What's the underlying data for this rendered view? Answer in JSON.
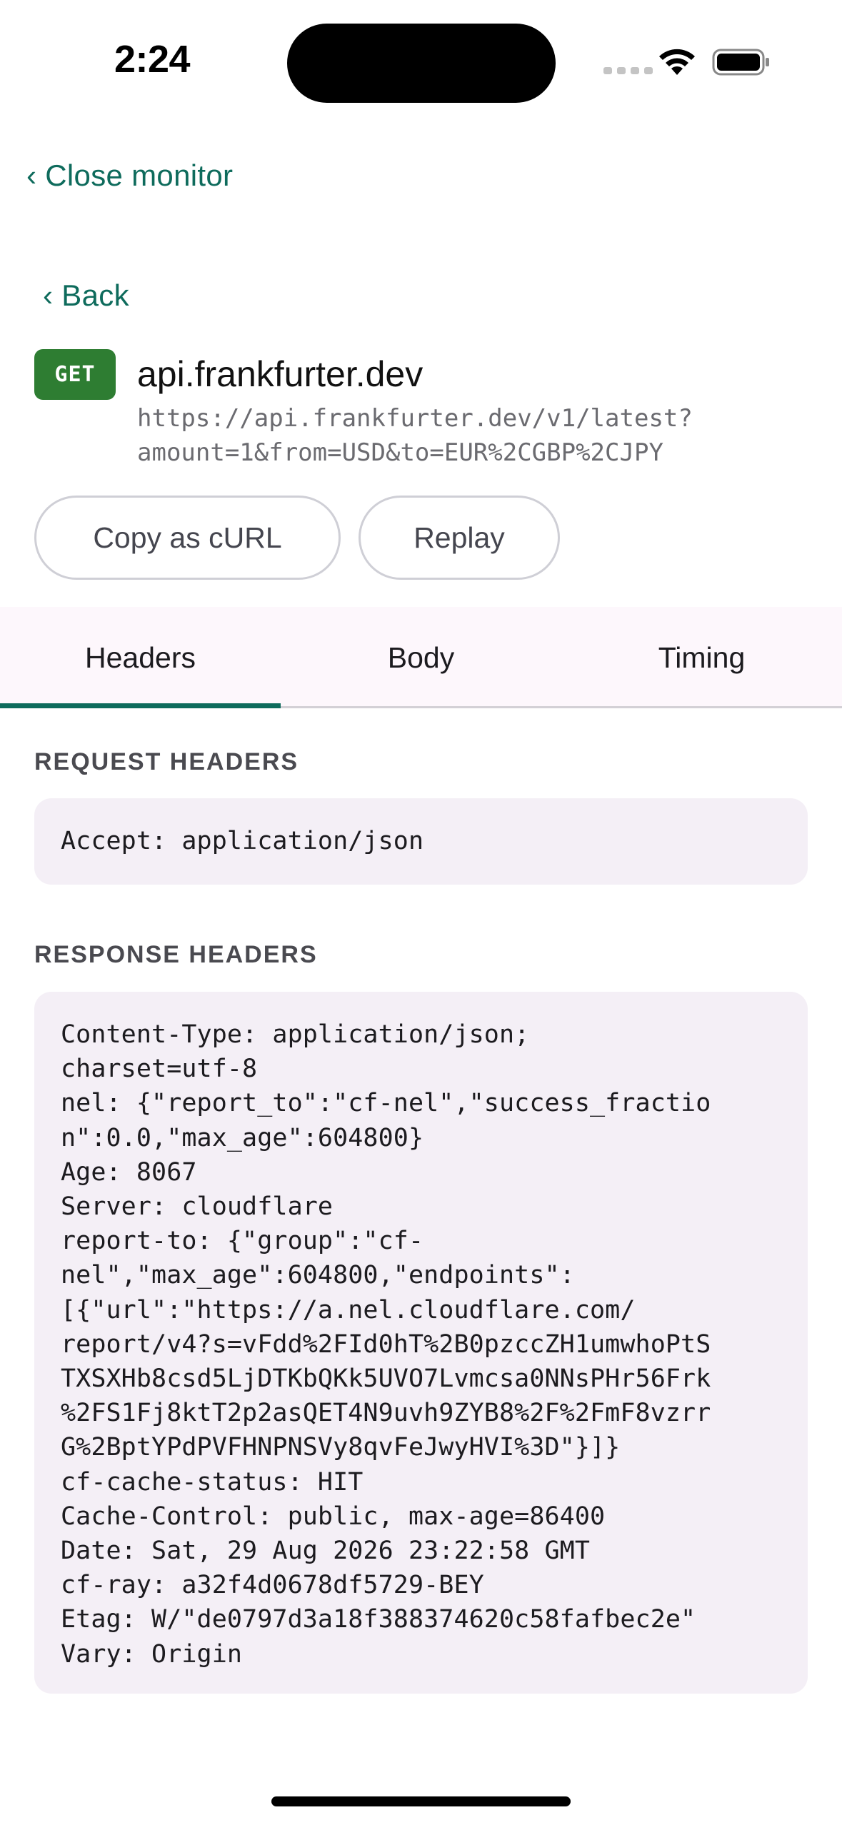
{
  "status_bar": {
    "time": "2:24"
  },
  "nav": {
    "close_monitor": "Close monitor",
    "back": "Back"
  },
  "request": {
    "method": "GET",
    "host": "api.frankfurter.dev",
    "url_lines": [
      "https://api.frankfurter.dev/v1/latest?",
      "amount=1&from=USD&to=EUR%2CGBP%2CJPY"
    ]
  },
  "actions": {
    "copy_curl": "Copy as cURL",
    "replay": "Replay"
  },
  "tabs": [
    {
      "label": "Headers",
      "selected": true
    },
    {
      "label": "Body",
      "selected": false
    },
    {
      "label": "Timing",
      "selected": false
    }
  ],
  "request_headers": {
    "title": "REQUEST HEADERS",
    "lines": [
      "Accept: application/json"
    ]
  },
  "response_headers": {
    "title": "RESPONSE HEADERS",
    "lines": [
      "Content-Type: application/json;",
      "charset=utf-8",
      "nel: {\"report_to\":\"cf-nel\",\"success_fractio",
      "n\":0.0,\"max_age\":604800}",
      "Age: 8067",
      "Server: cloudflare",
      "report-to: {\"group\":\"cf-",
      "nel\",\"max_age\":604800,\"endpoints\":",
      "[{\"url\":\"https://a.nel.cloudflare.com/",
      "report/v4?s=vFdd%2FId0hT%2B0pzccZH1umwhoPtS",
      "TXSXHb8csd5LjDTKbQKk5UVO7Lvmcsa0NNsPHr56Frk",
      "%2FS1Fj8ktT2p2asQET4N9uvh9ZYB8%2F%2FmF8vzrr",
      "G%2BptYPdPVFHNPNSVy8qvFeJwyHVI%3D\"}]}",
      "cf-cache-status: HIT",
      "Cache-Control: public, max-age=86400",
      "Date: Sat, 29 Aug 2026 23:22:58 GMT",
      "cf-ray: a32f4d0678df5729-BEY",
      "Etag: W/\"de0797d3a18f388374620c58fafbec2e\"",
      "Vary: Origin"
    ]
  },
  "colors": {
    "accent": "#0e6b5c",
    "method_badge": "#2e7d32",
    "tab_background": "#fdf7fc",
    "code_background": "#f4eff6"
  }
}
